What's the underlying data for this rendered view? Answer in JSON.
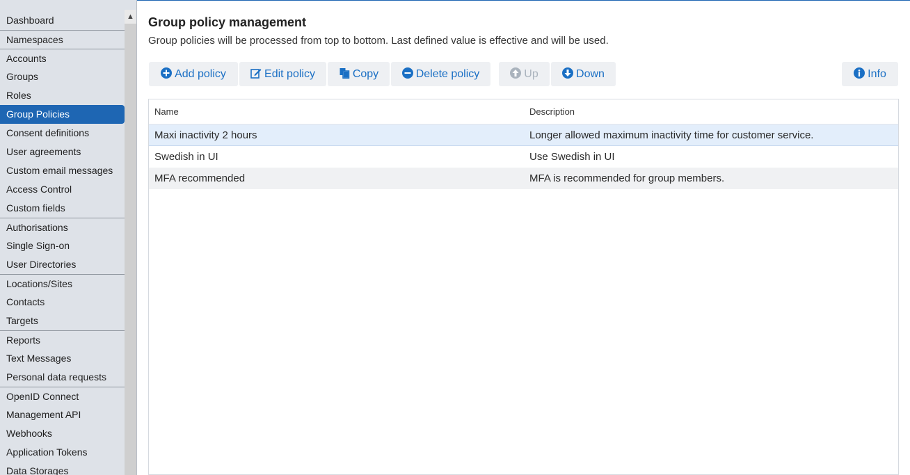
{
  "sidebar": {
    "items": [
      {
        "label": "Dashboard",
        "sep": false,
        "active": false
      },
      {
        "label": "Namespaces",
        "sep": true,
        "active": false
      },
      {
        "label": "Accounts",
        "sep": true,
        "active": false
      },
      {
        "label": "Groups",
        "sep": false,
        "active": false
      },
      {
        "label": "Roles",
        "sep": false,
        "active": false
      },
      {
        "label": "Group Policies",
        "sep": false,
        "active": true
      },
      {
        "label": "Consent definitions",
        "sep": false,
        "active": false
      },
      {
        "label": "User agreements",
        "sep": false,
        "active": false
      },
      {
        "label": "Custom email messages",
        "sep": false,
        "active": false
      },
      {
        "label": "Access Control",
        "sep": false,
        "active": false
      },
      {
        "label": "Custom fields",
        "sep": false,
        "active": false
      },
      {
        "label": "Authorisations",
        "sep": true,
        "active": false
      },
      {
        "label": "Single Sign-on",
        "sep": false,
        "active": false
      },
      {
        "label": "User Directories",
        "sep": false,
        "active": false
      },
      {
        "label": "Locations/Sites",
        "sep": true,
        "active": false
      },
      {
        "label": "Contacts",
        "sep": false,
        "active": false
      },
      {
        "label": "Targets",
        "sep": false,
        "active": false
      },
      {
        "label": "Reports",
        "sep": true,
        "active": false
      },
      {
        "label": "Text Messages",
        "sep": false,
        "active": false
      },
      {
        "label": "Personal data requests",
        "sep": false,
        "active": false
      },
      {
        "label": "OpenID Connect",
        "sep": true,
        "active": false
      },
      {
        "label": "Management API",
        "sep": false,
        "active": false
      },
      {
        "label": "Webhooks",
        "sep": false,
        "active": false
      },
      {
        "label": "Application Tokens",
        "sep": false,
        "active": false
      },
      {
        "label": "Data Storages",
        "sep": false,
        "active": false
      }
    ]
  },
  "page": {
    "title": "Group policy management",
    "subtitle": "Group policies will be processed from top to bottom. Last defined value is effective and will be used."
  },
  "toolbar": {
    "add": "Add policy",
    "edit": "Edit policy",
    "copy": "Copy",
    "delete": "Delete policy",
    "up": "Up",
    "down": "Down",
    "info": "Info"
  },
  "table": {
    "columns": [
      "Name",
      "Description"
    ],
    "rows": [
      {
        "name": "Maxi inactivity 2 hours",
        "description": "Longer allowed maximum inactivity time for customer service."
      },
      {
        "name": "Swedish in UI",
        "description": "Use Swedish in UI"
      },
      {
        "name": "MFA recommended",
        "description": "MFA is recommended for group members."
      }
    ]
  },
  "colors": {
    "accent": "#1e66b3",
    "link": "#1a6fc4",
    "sidebar_bg": "#dee2e8"
  }
}
